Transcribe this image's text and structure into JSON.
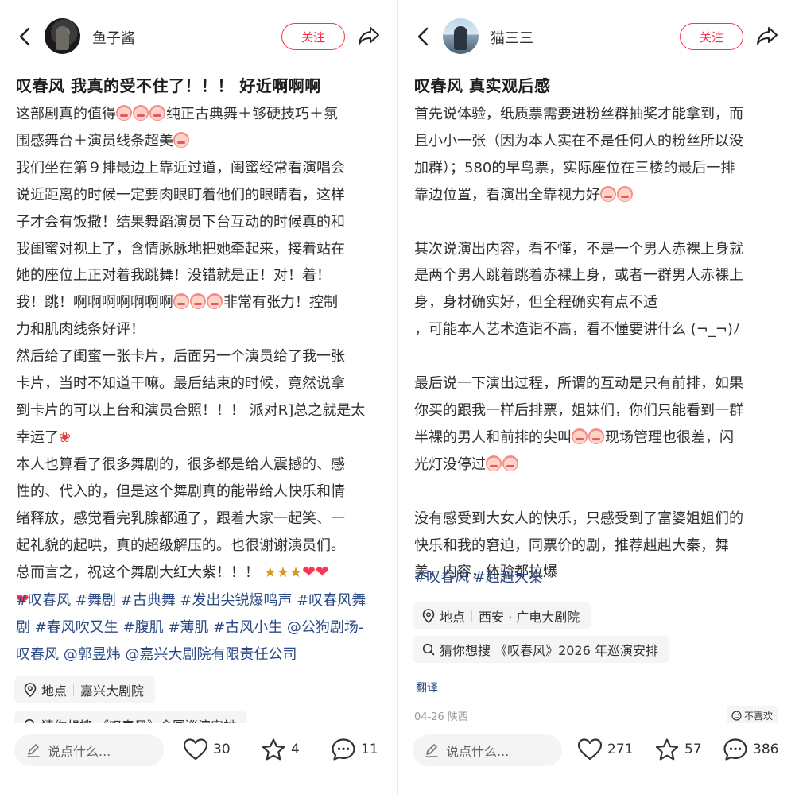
{
  "left": {
    "username": "鱼子酱",
    "follow_label": "关注",
    "title": "叹春风 我真的受不住了！！！ 好近啊啊啊",
    "lines": [
      [
        "这部剧真的值得",
        "{emo}",
        "{emo}",
        "{emo}",
        "纯正古典舞＋够硬技巧＋氛"
      ],
      [
        "围感舞台＋演员线条超美",
        "{emo}"
      ],
      [
        "我们坐在第９排最边上靠近过道，闺蜜经常看演唱会"
      ],
      [
        "说近距离的时候一定要肉眼盯着他们的眼睛看，这样"
      ],
      [
        "子才会有饭撒！结果舞蹈演员下台互动的时候真的和"
      ],
      [
        "我闺蜜对视上了，含情脉脉地把她牵起来，接着站在"
      ],
      [
        "她的座位上正对着我跳舞！没错就是正！对！着！"
      ],
      [
        "我！跳！啊啊啊啊啊啊啊",
        "{emo}",
        "{emo}",
        "{emo}",
        "非常有张力！控制"
      ],
      [
        "力和肌肉线条好评！"
      ],
      [
        "然后给了闺蜜一张卡片，后面另一个演员给了我一张"
      ],
      [
        "卡片，当时不知道干嘛。最后结束的时候，竟然说拿"
      ],
      [
        "到卡片的可以上台和演员合照！！！ 派对R]总之就是太"
      ],
      [
        "幸运了",
        "{rose}"
      ],
      [
        "本人也算看了很多舞剧的，很多都是给人震撼的、感"
      ],
      [
        "性的、代入的，但是这个舞剧真的能带给人快乐和情"
      ],
      [
        "绪释放，感觉看完乳腺都通了，跟着大家一起笑、一"
      ],
      [
        "起礼貌的起哄，真的超级解压的。也很谢谢演员们。"
      ],
      [
        "总而言之，祝这个舞剧大红大紫！！！ ",
        "{party}",
        "{party}",
        "{party}",
        "{heart}",
        "{heart}"
      ],
      [
        "{heart}"
      ]
    ],
    "tag_lines": [
      "#叹春风 #舞剧 #古典舞 #发出尖锐爆鸣声 #叹春风舞",
      "剧 #春风吹又生 #腹肌 #薄肌 #古风小生 @公狗剧场-",
      "叹春风 @郭昱炜 @嘉兴大剧院有限责任公司"
    ],
    "location_label": "地点",
    "location_value": "嘉兴大剧院",
    "guess_text": "猜你想搜 《叹春风》全国巡演安排",
    "comment_placeholder": "说点什么...",
    "likes": "30",
    "favorites": "4",
    "comments": "11"
  },
  "right": {
    "username": "猫三三",
    "follow_label": "关注",
    "title": "叹春风  真实观后感",
    "lines": [
      [
        "首先说体验，纸质票需要进粉丝群抽奖才能拿到，而"
      ],
      [
        "且小小一张（因为本人实在不是任何人的粉丝所以没"
      ],
      [
        "加群）；580的早鸟票，实际座位在三楼的最后一排"
      ],
      [
        "靠边位置，看演出全靠视力好",
        "{emo}",
        "{emo}"
      ],
      [
        ""
      ],
      [
        "其次说演出内容，看不懂，不是一个男人赤裸上身就"
      ],
      [
        "是两个男人跳着跳着赤裸上身，或者一群男人赤裸上"
      ],
      [
        "身，身材确实好，但全程确实有点不适"
      ],
      [
        "，可能本人艺术造诣不高，看不懂要讲什么 (¬_¬)ﾉ"
      ],
      [
        ""
      ],
      [
        "最后说一下演出过程，所谓的互动是只有前排，如果"
      ],
      [
        "你买的跟我一样后排票，姐妹们，你们只能看到一群"
      ],
      [
        "半裸的男人和前排的尖叫",
        "{emo}",
        "{emo}",
        "现场管理也很差，闪"
      ],
      [
        "光灯没停过",
        "{emo}",
        "{emo}"
      ],
      [
        ""
      ],
      [
        "没有感受到大女人的快乐，只感受到了富婆姐姐们的"
      ],
      [
        "快乐和我的窘迫，同票价的剧，推荐赳赳大秦，舞"
      ],
      [
        "美，内容，体验都拉爆"
      ]
    ],
    "tag_lines": [
      "#叹春风 #赳赳大秦"
    ],
    "location_label": "地点",
    "location_value": "西安 · 广电大剧院",
    "guess_text": "猜你想搜 《叹春风》2026 年巡演安排",
    "translate_label": "翻译",
    "date_location": "04-26 陕西",
    "dislike_label": "不喜欢",
    "comment_placeholder": "说点什么...",
    "likes": "271",
    "favorites": "57",
    "comments": "386"
  },
  "colors": {
    "accent_red": "#ff2e4d",
    "link_blue": "#2b4a86"
  },
  "icons": [
    "back-arrow-icon",
    "share-icon",
    "location-pin-icon",
    "search-icon",
    "pencil-icon",
    "heart-icon",
    "star-icon",
    "comment-bubble-icon",
    "emoji-icon",
    "rose-icon",
    "party-popper-icon"
  ]
}
